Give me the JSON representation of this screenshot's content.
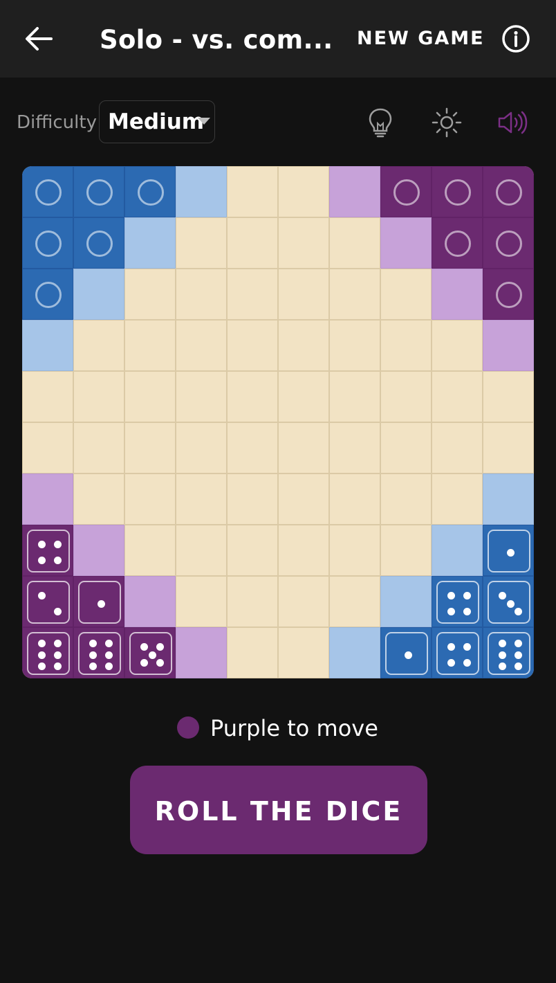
{
  "header": {
    "back_icon": "arrow-left-icon",
    "title": "Solo - vs. com...",
    "new_game_label": "NEW GAME",
    "info_icon": "info-icon"
  },
  "toolbar": {
    "difficulty_label": "Difficulty",
    "difficulty_value": "Medium",
    "hint_icon": "lightbulb-icon",
    "theme_icon": "sun-icon",
    "sound_icon": "speaker-icon"
  },
  "board": {
    "size": 10,
    "colors": {
      "cream": "#f2e3c4",
      "light_blue": "#a6c5e8",
      "light_purple": "#c7a2d9",
      "blue": "#2c6ab2",
      "purple": "#6b2a70"
    },
    "rows": [
      [
        "B",
        "B",
        "B",
        "b",
        "_",
        "_",
        "p",
        "P",
        "P",
        "P"
      ],
      [
        "B",
        "B",
        "b",
        "_",
        "_",
        "_",
        "_",
        "p",
        "P",
        "P"
      ],
      [
        "B",
        "b",
        "_",
        "_",
        "_",
        "_",
        "_",
        "_",
        "p",
        "P"
      ],
      [
        "b",
        "_",
        "_",
        "_",
        "_",
        "_",
        "_",
        "_",
        "_",
        "p"
      ],
      [
        "_",
        "_",
        "_",
        "_",
        "_",
        "_",
        "_",
        "_",
        "_",
        "_"
      ],
      [
        "_",
        "_",
        "_",
        "_",
        "_",
        "_",
        "_",
        "_",
        "_",
        "_"
      ],
      [
        "p",
        "_",
        "_",
        "_",
        "_",
        "_",
        "_",
        "_",
        "_",
        "b"
      ],
      [
        "P",
        "p",
        "_",
        "_",
        "_",
        "_",
        "_",
        "_",
        "b",
        "B"
      ],
      [
        "P",
        "P",
        "p",
        "_",
        "_",
        "_",
        "_",
        "b",
        "B",
        "B"
      ],
      [
        "P",
        "P",
        "P",
        "p",
        "_",
        "_",
        "b",
        "B",
        "B",
        "B"
      ]
    ],
    "pieces": [
      {
        "row": 0,
        "col": 0,
        "kind": "ring"
      },
      {
        "row": 0,
        "col": 1,
        "kind": "ring"
      },
      {
        "row": 0,
        "col": 2,
        "kind": "ring"
      },
      {
        "row": 1,
        "col": 0,
        "kind": "ring"
      },
      {
        "row": 1,
        "col": 1,
        "kind": "ring"
      },
      {
        "row": 2,
        "col": 0,
        "kind": "ring"
      },
      {
        "row": 0,
        "col": 7,
        "kind": "ring"
      },
      {
        "row": 0,
        "col": 8,
        "kind": "ring"
      },
      {
        "row": 0,
        "col": 9,
        "kind": "ring"
      },
      {
        "row": 1,
        "col": 8,
        "kind": "ring"
      },
      {
        "row": 1,
        "col": 9,
        "kind": "ring"
      },
      {
        "row": 2,
        "col": 9,
        "kind": "ring"
      },
      {
        "row": 7,
        "col": 0,
        "kind": "die",
        "value": 4
      },
      {
        "row": 8,
        "col": 0,
        "kind": "die",
        "value": 2
      },
      {
        "row": 8,
        "col": 1,
        "kind": "die",
        "value": 1
      },
      {
        "row": 9,
        "col": 0,
        "kind": "die",
        "value": 6
      },
      {
        "row": 9,
        "col": 1,
        "kind": "die",
        "value": 6
      },
      {
        "row": 9,
        "col": 2,
        "kind": "die",
        "value": 5
      },
      {
        "row": 7,
        "col": 9,
        "kind": "die",
        "value": 1
      },
      {
        "row": 8,
        "col": 8,
        "kind": "die",
        "value": 4
      },
      {
        "row": 8,
        "col": 9,
        "kind": "die",
        "value": 3
      },
      {
        "row": 9,
        "col": 7,
        "kind": "die",
        "value": 1
      },
      {
        "row": 9,
        "col": 8,
        "kind": "die",
        "value": 4
      },
      {
        "row": 9,
        "col": 9,
        "kind": "die",
        "value": 6
      }
    ]
  },
  "status": {
    "turn_text": "Purple to move",
    "turn_color": "#6b2a70"
  },
  "action": {
    "roll_label": "ROLL THE DICE",
    "button_color": "#6b2a70"
  }
}
